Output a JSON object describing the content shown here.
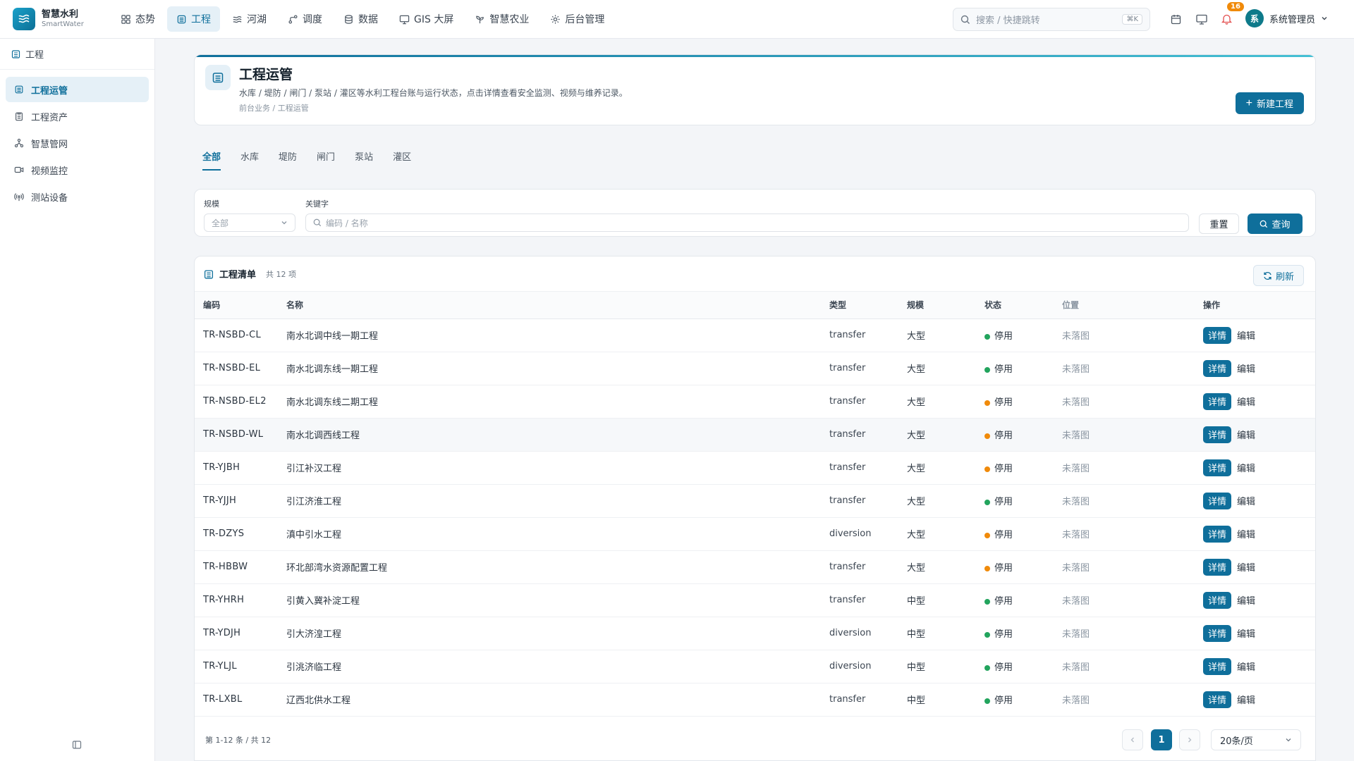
{
  "brand": {
    "name": "智慧水利",
    "sub": "SmartWater"
  },
  "nav": [
    {
      "label": "态势",
      "icon": "dashboard-icon",
      "active": false
    },
    {
      "label": "工程",
      "icon": "building-icon",
      "active": true
    },
    {
      "label": "河湖",
      "icon": "waves-icon",
      "active": false
    },
    {
      "label": "调度",
      "icon": "route-icon",
      "active": false
    },
    {
      "label": "数据",
      "icon": "database-icon",
      "active": false
    },
    {
      "label": "GIS 大屏",
      "icon": "monitor-icon",
      "active": false
    },
    {
      "label": "智慧农业",
      "icon": "sprout-icon",
      "active": false
    },
    {
      "label": "后台管理",
      "icon": "gear-icon",
      "active": false
    }
  ],
  "search": {
    "placeholder": "搜索 / 快捷跳转",
    "shortcut": "⌘K"
  },
  "notifications": {
    "count": "16"
  },
  "user": {
    "avatar": "系",
    "name": "系统管理员"
  },
  "sidebar": {
    "header": "工程",
    "items": [
      {
        "label": "工程运管",
        "icon": "building-icon",
        "active": true
      },
      {
        "label": "工程资产",
        "icon": "clipboard-icon",
        "active": false
      },
      {
        "label": "智慧管网",
        "icon": "network-icon",
        "active": false
      },
      {
        "label": "视频监控",
        "icon": "video-icon",
        "active": false
      },
      {
        "label": "测站设备",
        "icon": "signal-icon",
        "active": false
      }
    ]
  },
  "page": {
    "title": "工程运管",
    "description": "水库 / 堤防 / 闸门 / 泵站 / 灌区等水利工程台账与运行状态，点击详情查看安全监测、视频与维养记录。",
    "breadcrumb": "前台业务 / 工程运管",
    "new_button": "新建工程"
  },
  "tabs": [
    {
      "label": "全部",
      "active": true
    },
    {
      "label": "水库",
      "active": false
    },
    {
      "label": "堤防",
      "active": false
    },
    {
      "label": "闸门",
      "active": false
    },
    {
      "label": "泵站",
      "active": false
    },
    {
      "label": "灌区",
      "active": false
    }
  ],
  "filters": {
    "scale_label": "规模",
    "scale_value": "全部",
    "keyword_label": "关键字",
    "keyword_placeholder": "编码 / 名称",
    "reset": "重置",
    "query": "查询"
  },
  "table": {
    "title": "工程清单",
    "count": "共 12 项",
    "refresh": "刷新",
    "columns": [
      "编码",
      "名称",
      "类型",
      "规模",
      "状态",
      "位置",
      "操作"
    ],
    "detail_label": "详情",
    "edit_label": "编辑",
    "status_colors": {
      "green": "#22a45d",
      "orange": "#f08a0a"
    },
    "rows": [
      {
        "code": "TR-NSBD-CL",
        "name": "南水北调中线一期工程",
        "type": "transfer",
        "scale": "大型",
        "status": "停用",
        "status_color": "green",
        "location": "未落图"
      },
      {
        "code": "TR-NSBD-EL",
        "name": "南水北调东线一期工程",
        "type": "transfer",
        "scale": "大型",
        "status": "停用",
        "status_color": "green",
        "location": "未落图"
      },
      {
        "code": "TR-NSBD-EL2",
        "name": "南水北调东线二期工程",
        "type": "transfer",
        "scale": "大型",
        "status": "停用",
        "status_color": "orange",
        "location": "未落图"
      },
      {
        "code": "TR-NSBD-WL",
        "name": "南水北调西线工程",
        "type": "transfer",
        "scale": "大型",
        "status": "停用",
        "status_color": "orange",
        "location": "未落图"
      },
      {
        "code": "TR-YJBH",
        "name": "引江补汉工程",
        "type": "transfer",
        "scale": "大型",
        "status": "停用",
        "status_color": "orange",
        "location": "未落图"
      },
      {
        "code": "TR-YJJH",
        "name": "引江济淮工程",
        "type": "transfer",
        "scale": "大型",
        "status": "停用",
        "status_color": "green",
        "location": "未落图"
      },
      {
        "code": "TR-DZYS",
        "name": "滇中引水工程",
        "type": "diversion",
        "scale": "大型",
        "status": "停用",
        "status_color": "orange",
        "location": "未落图"
      },
      {
        "code": "TR-HBBW",
        "name": "环北部湾水资源配置工程",
        "type": "transfer",
        "scale": "大型",
        "status": "停用",
        "status_color": "orange",
        "location": "未落图"
      },
      {
        "code": "TR-YHRH",
        "name": "引黄入冀补淀工程",
        "type": "transfer",
        "scale": "中型",
        "status": "停用",
        "status_color": "green",
        "location": "未落图"
      },
      {
        "code": "TR-YDJH",
        "name": "引大济湟工程",
        "type": "diversion",
        "scale": "中型",
        "status": "停用",
        "status_color": "green",
        "location": "未落图"
      },
      {
        "code": "TR-YLJL",
        "name": "引洮济临工程",
        "type": "diversion",
        "scale": "中型",
        "status": "停用",
        "status_color": "green",
        "location": "未落图"
      },
      {
        "code": "TR-LXBL",
        "name": "辽西北供水工程",
        "type": "transfer",
        "scale": "中型",
        "status": "停用",
        "status_color": "green",
        "location": "未落图"
      }
    ]
  },
  "pagination": {
    "summary": "第 1-12 条 / 共 12",
    "current": "1",
    "page_size": "20条/页"
  }
}
